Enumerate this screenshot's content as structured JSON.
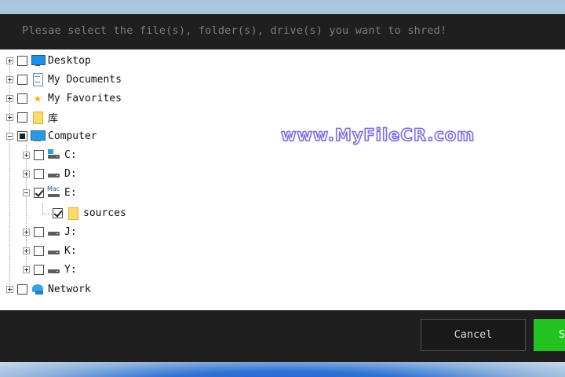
{
  "dialog": {
    "prompt": "Plesae select the file(s), folder(s), drive(s) you want to shred!"
  },
  "tree": {
    "desktop": "Desktop",
    "my_documents": "My Documents",
    "my_favorites": "My Favorites",
    "library": "库",
    "computer": "Computer",
    "drive_c": "C:",
    "drive_d": "D:",
    "drive_e": "E:",
    "drive_e_mac_label": "Mac",
    "sources": "sources",
    "drive_j": "J:",
    "drive_k": "K:",
    "drive_y": "Y:",
    "network": "Network"
  },
  "watermark": "www.MyFileCR.com",
  "buttons": {
    "cancel": "Cancel",
    "shred": "Shred"
  },
  "colors": {
    "accent_green": "#22c321",
    "dialog_bg": "#1f1f1f",
    "watermark_outline": "#7b6fe0"
  }
}
